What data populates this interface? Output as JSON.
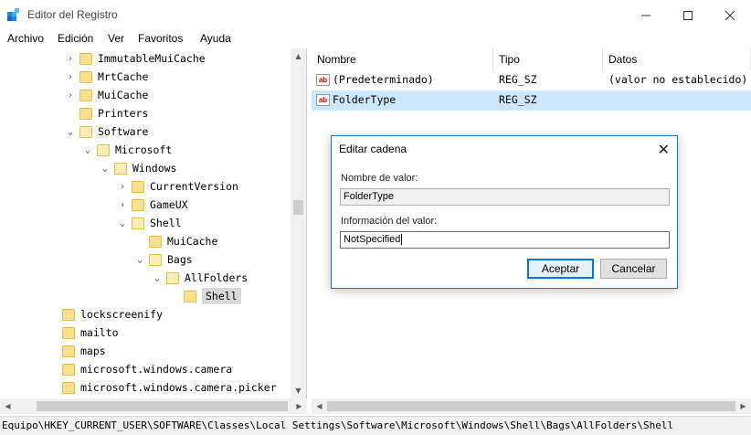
{
  "window": {
    "title": "Editor del Registro"
  },
  "menu": [
    "Archivo",
    "Edición",
    "Ver",
    "Favoritos",
    "Ayuda"
  ],
  "tree": [
    {
      "label": "ImmutableMuiCache",
      "depth": 1,
      "expander": "collapsed"
    },
    {
      "label": "MrtCache",
      "depth": 1,
      "expander": "collapsed"
    },
    {
      "label": "MuiCache",
      "depth": 1,
      "expander": "collapsed"
    },
    {
      "label": "Printers",
      "depth": 1,
      "expander": "none"
    },
    {
      "label": "Software",
      "depth": 1,
      "expander": "expanded"
    },
    {
      "label": "Microsoft",
      "depth": 2,
      "expander": "expanded"
    },
    {
      "label": "Windows",
      "depth": 3,
      "expander": "expanded"
    },
    {
      "label": "CurrentVersion",
      "depth": 4,
      "expander": "collapsed"
    },
    {
      "label": "GameUX",
      "depth": 4,
      "expander": "collapsed"
    },
    {
      "label": "Shell",
      "depth": 4,
      "expander": "expanded"
    },
    {
      "label": "MuiCache",
      "depth": 5,
      "expander": "none"
    },
    {
      "label": "Bags",
      "depth": 5,
      "expander": "expanded"
    },
    {
      "label": "AllFolders",
      "depth": 6,
      "expander": "expanded"
    },
    {
      "label": "Shell",
      "depth": 7,
      "expander": "none",
      "selected": true
    },
    {
      "label": "lockscreenify",
      "depth": 0,
      "expander": "none"
    },
    {
      "label": "mailto",
      "depth": 0,
      "expander": "none"
    },
    {
      "label": "maps",
      "depth": 0,
      "expander": "none"
    },
    {
      "label": "microsoft.windows.camera",
      "depth": 0,
      "expander": "none"
    },
    {
      "label": "microsoft.windows.camera.picker",
      "depth": 0,
      "expander": "none"
    }
  ],
  "list": {
    "headers": {
      "name": "Nombre",
      "type": "Tipo",
      "data": "Datos"
    },
    "rows": [
      {
        "name": "(Predeterminado)",
        "type": "REG_SZ",
        "data": "(valor no establecido)",
        "icon": "string-value-icon"
      },
      {
        "name": "FolderType",
        "type": "REG_SZ",
        "data": "",
        "icon": "string-value-icon",
        "selected": true
      }
    ]
  },
  "dialog": {
    "title": "Editar cadena",
    "name_label": "Nombre de valor:",
    "name_value": "FolderType",
    "data_label": "Información del valor:",
    "data_value": "NotSpecified",
    "ok_label": "Aceptar",
    "cancel_label": "Cancelar"
  },
  "status": {
    "path": "Equipo\\HKEY_CURRENT_USER\\SOFTWARE\\Classes\\Local Settings\\Software\\Microsoft\\Windows\\Shell\\Bags\\AllFolders\\Shell"
  },
  "colors": {
    "accent": "#0078d7",
    "selection": "#cce8ff",
    "folder": "#f9e08a"
  }
}
